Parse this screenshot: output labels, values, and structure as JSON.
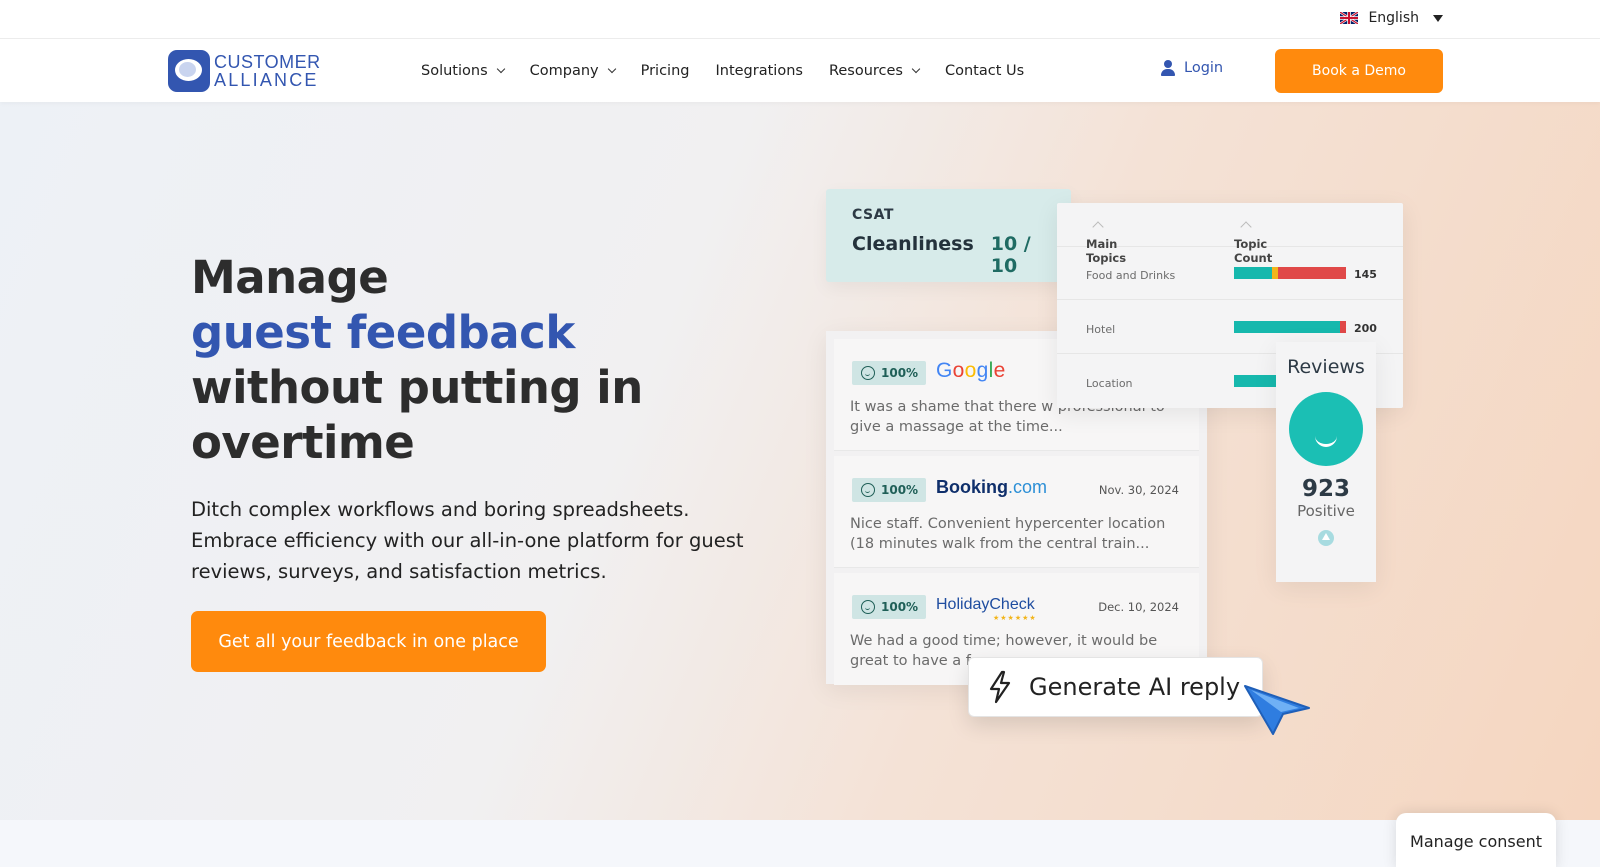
{
  "language": {
    "label": "English",
    "icon": "uk-flag-icon"
  },
  "brand": {
    "line1": "CUSTOMER",
    "line2": "ALLIANCE",
    "color": "#3356b0"
  },
  "nav": {
    "items": [
      {
        "label": "Solutions",
        "has_dropdown": true
      },
      {
        "label": "Company",
        "has_dropdown": true
      },
      {
        "label": "Pricing",
        "has_dropdown": false
      },
      {
        "label": "Integrations",
        "has_dropdown": false
      },
      {
        "label": "Resources",
        "has_dropdown": true
      },
      {
        "label": "Contact Us",
        "has_dropdown": false
      }
    ],
    "login": "Login",
    "demo": "Book a Demo"
  },
  "hero": {
    "title_line1": "Manage",
    "title_accent": "guest feedback",
    "title_line3": "without putting in",
    "title_line4": "overtime",
    "subtitle": "Ditch complex workflows and boring spreadsheets. Embrace efficiency with our all-in-one platform for guest reviews, surveys, and satisfaction metrics.",
    "cta": "Get all your feedback in one place"
  },
  "csat": {
    "label": "CSAT",
    "metric": "Cleanliness",
    "score": "10 / 10"
  },
  "topics": {
    "col1": "Main Topics",
    "col2": "Topic Count",
    "rows": [
      {
        "name": "Food and Drinks",
        "count": "145"
      },
      {
        "name": "Hotel",
        "count": "200"
      },
      {
        "name": "Location",
        "count": ""
      }
    ]
  },
  "reviews": [
    {
      "score": "100%",
      "source": "Google",
      "date": "",
      "text": "It was a shame that there w professional to give a massage at the time..."
    },
    {
      "score": "100%",
      "source_name": "Booking",
      "source_suffix": ".com",
      "date": "Nov. 30, 2024",
      "text": "Nice staff. Convenient hypercenter location (18 minutes walk from the central train..."
    },
    {
      "score": "100%",
      "source": "HolidayCheck",
      "date": "Dec. 10, 2024",
      "text": "We had a good time; however, it would be great to have a f"
    }
  ],
  "review_stat": {
    "title": "Reviews",
    "count": "923",
    "label": "Positive"
  },
  "ai_reply": "Generate AI reply",
  "consent": "Manage consent",
  "colors": {
    "accent_orange": "#ff8a0d",
    "brand_blue": "#3356b0",
    "teal": "#1bbfb4"
  }
}
